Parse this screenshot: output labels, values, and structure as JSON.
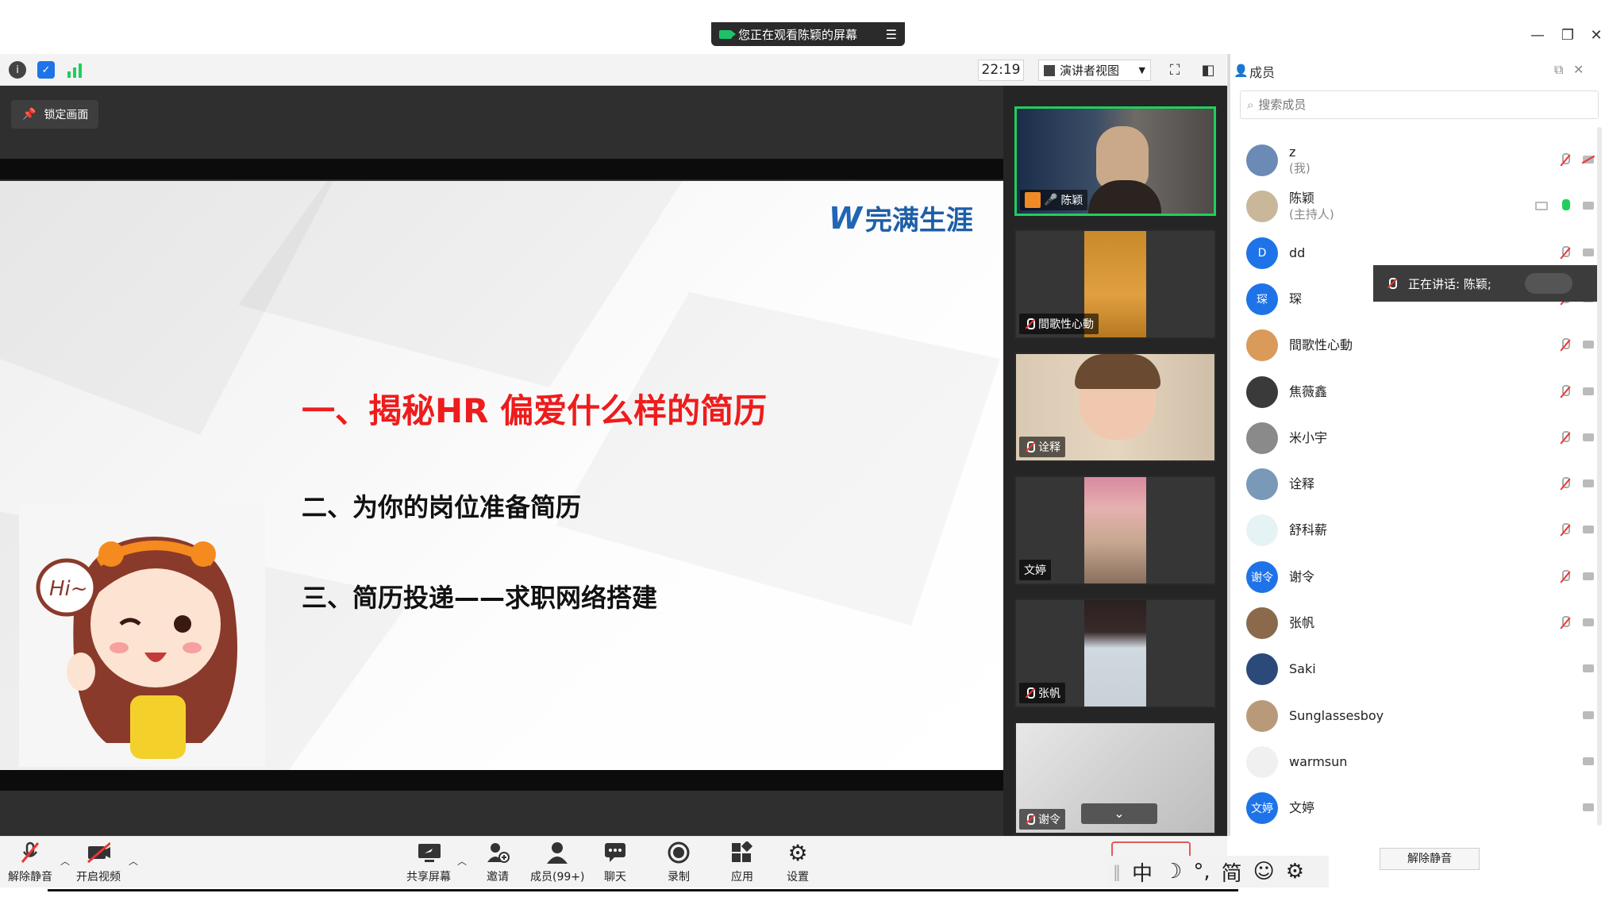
{
  "window": {
    "sharing_banner": "您正在观看陈颖的屏幕",
    "minimize_icon": "minimize-icon",
    "restore_icon": "restore-icon",
    "close_icon": "close-icon"
  },
  "toolbar": {
    "time": "22:19",
    "view_mode": "演讲者视图",
    "icons": [
      "info-icon",
      "shield-icon",
      "signal-icon",
      "fullscreen-icon",
      "sidebar-toggle-icon"
    ]
  },
  "share": {
    "lock_label": "锁定画面",
    "slide": {
      "logo_text": "完满生涯",
      "heading1": "一、揭秘HR 偏爱什么样的简历",
      "heading2": "二、为你的岗位准备简历",
      "heading3": "三、简历投递——求职网络搭建",
      "bubble_text": "Hi~"
    }
  },
  "gallery": [
    {
      "name": "陈颖",
      "active": true
    },
    {
      "name": "間歌性心動"
    },
    {
      "name": "诠释"
    },
    {
      "name": "文婷"
    },
    {
      "name": "张帆"
    },
    {
      "name": "谢令"
    }
  ],
  "members_panel": {
    "title": "成员",
    "search_placeholder": "搜索成员",
    "speaking_label": "正在讲话: 陈颖;",
    "members": [
      {
        "name": "z",
        "role": "(我)",
        "avatar_color": "#6b8ab5",
        "avatar_text": "",
        "mic": "off",
        "cam": "off"
      },
      {
        "name": "陈颖",
        "role": "(主持人)",
        "avatar_color": "#c9b79a",
        "avatar_text": "",
        "mic": "on",
        "cam": "on"
      },
      {
        "name": "dd",
        "role": "",
        "avatar_color": "#1f73e8",
        "avatar_text": "D",
        "mic": "off",
        "cam": "on"
      },
      {
        "name": "琛",
        "role": "",
        "avatar_color": "#1f73e8",
        "avatar_text": "琛",
        "mic": "off",
        "cam": "on"
      },
      {
        "name": "間歌性心動",
        "role": "",
        "avatar_color": "#d99a5a",
        "avatar_text": "",
        "mic": "off",
        "cam": "on"
      },
      {
        "name": "焦薇鑫",
        "role": "",
        "avatar_color": "#3a3a3a",
        "avatar_text": "",
        "mic": "off",
        "cam": "on"
      },
      {
        "name": "米小宇",
        "role": "",
        "avatar_color": "#8a8a8a",
        "avatar_text": "",
        "mic": "off",
        "cam": "on"
      },
      {
        "name": "诠释",
        "role": "",
        "avatar_color": "#7a98b8",
        "avatar_text": "",
        "mic": "off",
        "cam": "on"
      },
      {
        "name": "舒科薪",
        "role": "",
        "avatar_color": "#e6f3f5",
        "avatar_text": "",
        "mic": "off",
        "cam": "on"
      },
      {
        "name": "谢令",
        "role": "",
        "avatar_color": "#1f73e8",
        "avatar_text": "谢令",
        "mic": "off",
        "cam": "on"
      },
      {
        "name": "张帆",
        "role": "",
        "avatar_color": "#8a6a4a",
        "avatar_text": "",
        "mic": "off",
        "cam": "on"
      },
      {
        "name": "Saki",
        "role": "",
        "avatar_color": "#2b4a7a",
        "avatar_text": "",
        "mic": "none",
        "cam": "on"
      },
      {
        "name": "Sunglassesboy",
        "role": "",
        "avatar_color": "#b89a7a",
        "avatar_text": "",
        "mic": "none",
        "cam": "on"
      },
      {
        "name": "warmsun",
        "role": "",
        "avatar_color": "#f0f0f0",
        "avatar_text": "",
        "mic": "none",
        "cam": "on"
      },
      {
        "name": "文婷",
        "role": "",
        "avatar_color": "#1f73e8",
        "avatar_text": "文婷",
        "mic": "none",
        "cam": "on"
      }
    ],
    "unmute_all_label": "解除静音"
  },
  "bottom_bar": {
    "unmute": "解除静音",
    "start_video": "开启视频",
    "share_screen": "共享屏幕",
    "invite": "邀请",
    "members": "成员(99+)",
    "chat": "聊天",
    "record": "录制",
    "apps": "应用",
    "settings": "设置"
  },
  "ime": {
    "mode": "中",
    "moon": "☽",
    "punct": "°,",
    "simplified": "简",
    "emoji": "☺",
    "gear": "⚙"
  },
  "colors": {
    "accent_blue": "#1f73e8",
    "active_green": "#1fcf5c",
    "slide_red": "#ee1c1c",
    "mute_red": "#e33333"
  }
}
